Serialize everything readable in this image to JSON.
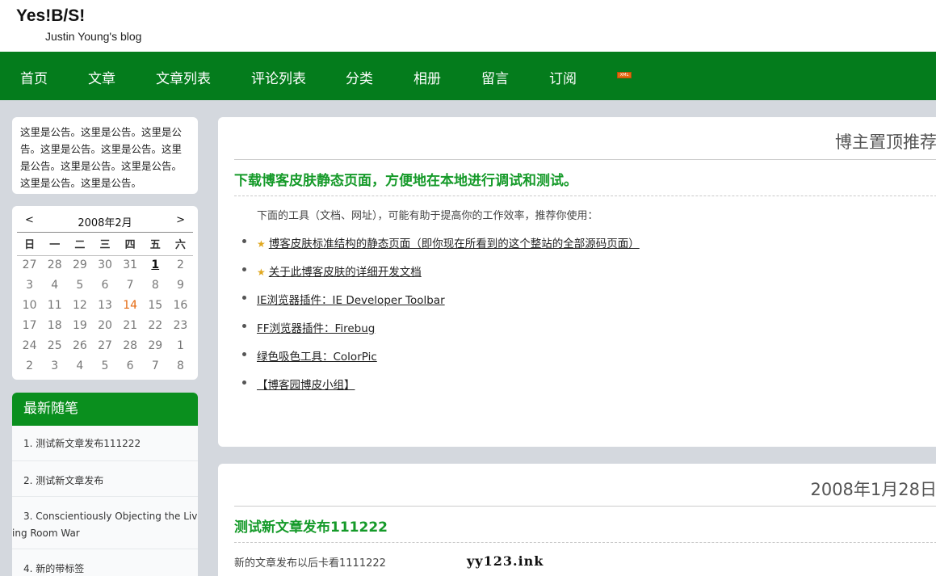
{
  "header": {
    "title": "Yes!B/S!",
    "subtitle": "Justin Young's blog"
  },
  "nav": {
    "items": [
      {
        "label": "首页"
      },
      {
        "label": "文章"
      },
      {
        "label": "文章列表"
      },
      {
        "label": "评论列表"
      },
      {
        "label": "分类"
      },
      {
        "label": "相册"
      },
      {
        "label": "留言"
      },
      {
        "label": "订阅"
      }
    ],
    "rss_label": "XML",
    "rss_icon": "rss-feed-icon"
  },
  "notice": {
    "text": "这里是公告。这里是公告。这里是公告。这里是公告。这里是公告。这里是公告。这里是公告。这里是公告。这里是公告。这里是公告。"
  },
  "calendar": {
    "prev": "<",
    "next": ">",
    "title": "2008年2月",
    "weekdays": [
      "日",
      "一",
      "二",
      "三",
      "四",
      "五",
      "六"
    ],
    "weeks": [
      [
        "27",
        "28",
        "29",
        "30",
        "31",
        "1",
        "2"
      ],
      [
        "3",
        "4",
        "5",
        "6",
        "7",
        "8",
        "9"
      ],
      [
        "10",
        "11",
        "12",
        "13",
        "14",
        "15",
        "16"
      ],
      [
        "17",
        "18",
        "19",
        "20",
        "21",
        "22",
        "23"
      ],
      [
        "24",
        "25",
        "26",
        "27",
        "28",
        "29",
        "1"
      ],
      [
        "2",
        "3",
        "4",
        "5",
        "6",
        "7",
        "8"
      ]
    ],
    "linked_day": "1",
    "today": "14"
  },
  "recent": {
    "title": "最新随笔",
    "items": [
      "1. 测试新文章发布111222",
      "2. 测试新文章发布",
      "3. Conscientiously Objecting the Living Room War",
      "4. 新的带标签"
    ]
  },
  "pinned": {
    "section_title": "博主置顶推荐",
    "post_title": "下载博客皮肤静态页面，方便地在本地进行调试和测试。",
    "intro": "下面的工具（文档、网址），可能有助于提高你的工作效率，推荐你使用：",
    "links": [
      {
        "label": "博客皮肤标准结构的静态页面（即你现在所看到的这个整站的全部源码页面）",
        "starred": true
      },
      {
        "label": "关于此博客皮肤的详细开发文档",
        "starred": true
      },
      {
        "label": "IE浏览器插件：IE Developer Toolbar",
        "starred": false
      },
      {
        "label": "FF浏览器插件：Firebug",
        "starred": false
      },
      {
        "label": "绿色吸色工具：ColorPic",
        "starred": false
      },
      {
        "label": "【博客园博皮小组】",
        "starred": false
      }
    ]
  },
  "post2": {
    "date": "2008年1月28日",
    "title": "测试新文章发布111222",
    "desc": "新的文章发布以后卡看1111222"
  },
  "watermark": "yy123.ink",
  "colors": {
    "nav_bg": "#047c1c",
    "post_title": "#159a29",
    "page_bg": "#d4d8de"
  }
}
